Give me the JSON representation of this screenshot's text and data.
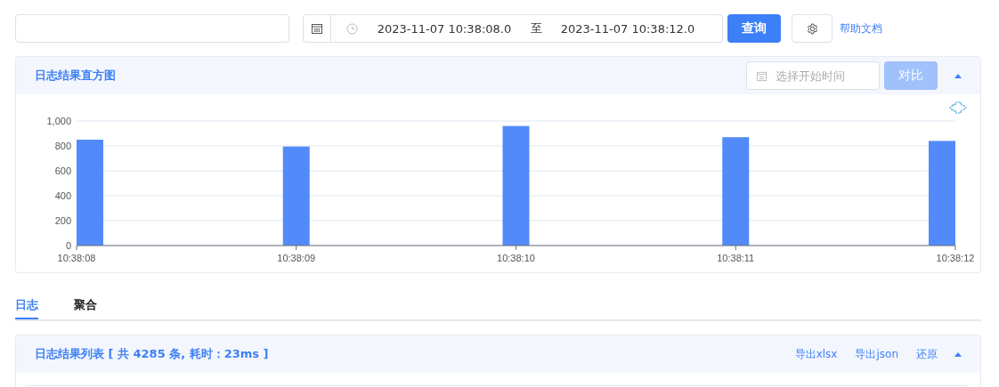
{
  "toolbar": {
    "time_range": {
      "start": "2023-11-07 10:38:08.0",
      "separator": "至",
      "end": "2023-11-07 10:38:12.0"
    },
    "query_button": "查询",
    "help_link": "帮助文档"
  },
  "histogram_panel": {
    "title": "日志结果直方图",
    "compare_start": {
      "placeholder": "选择开始时间"
    },
    "compare_button": {
      "label": "对比",
      "disabled": true
    },
    "expanded": true,
    "chart_data": {
      "type": "bar",
      "categories": [
        "10:38:08",
        "10:38:09",
        "10:38:10",
        "10:38:11",
        "10:38:12"
      ],
      "grid": true,
      "series": [
        {
          "color": "#528bf9",
          "values": [
            850,
            795,
            960,
            870,
            840
          ]
        }
      ],
      "ylim": [
        0,
        1000
      ],
      "yticks": [
        0,
        200,
        400,
        600,
        800,
        {
          "value": 1000,
          "label": "1,000"
        }
      ]
    }
  },
  "tabs": [
    {
      "label": "日志",
      "selected": true
    },
    {
      "label": "聚合",
      "selected": false
    }
  ],
  "list_panel": {
    "title": "日志结果列表 [ 共 4285 条, 耗时：23ms ]",
    "actions": [
      "导出xlsx",
      "导出json",
      "还原"
    ],
    "expanded": true
  }
}
